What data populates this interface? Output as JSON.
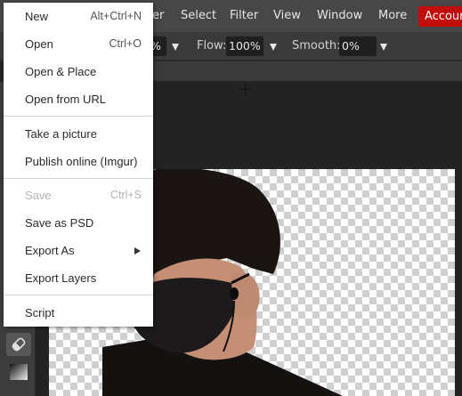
{
  "menubar": {
    "items": [
      "er",
      "Select",
      "Filter",
      "View",
      "Window",
      "More"
    ],
    "account_label": "Accoun"
  },
  "options": {
    "opacity_value": "%",
    "flow_label": "Flow:",
    "flow_value": "100%",
    "smooth_label": "Smooth:",
    "smooth_value": "0%"
  },
  "file_menu": {
    "items": [
      {
        "label": "New",
        "shortcut": "Alt+Ctrl+N"
      },
      {
        "label": "Open",
        "shortcut": "Ctrl+O"
      },
      {
        "label": "Open & Place",
        "shortcut": ""
      },
      {
        "label": "Open from URL",
        "shortcut": ""
      },
      {
        "label": "Take a picture",
        "shortcut": ""
      },
      {
        "label": "Publish online (Imgur)",
        "shortcut": ""
      },
      {
        "label": "Save",
        "shortcut": "Ctrl+S",
        "disabled": true
      },
      {
        "label": "Save as PSD",
        "shortcut": ""
      },
      {
        "label": "Export As",
        "shortcut": "",
        "submenu": true
      },
      {
        "label": "Export Layers",
        "shortcut": ""
      },
      {
        "label": "Script",
        "shortcut": ""
      }
    ]
  },
  "colors": {
    "menubar_bg": "#474747",
    "account_bg": "#c30c0c",
    "menu_bg": "#ffffff"
  }
}
